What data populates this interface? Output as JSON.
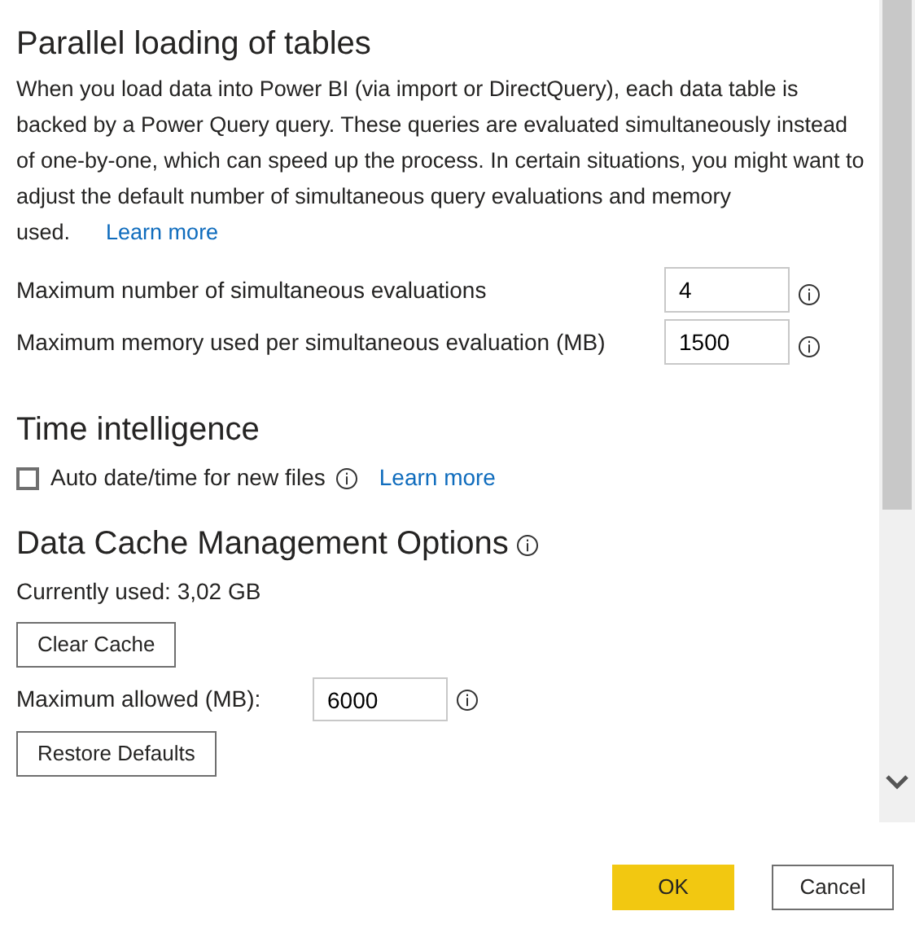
{
  "parallel_loading": {
    "heading": "Parallel loading of tables",
    "description": "When you load data into Power BI (via import or DirectQuery), each data table is backed by a Power Query query. These queries are evaluated simultaneously instead of one-by-one, which can speed up the process. In certain situations, you might want to adjust the default number of simultaneous query evaluations and memory used.",
    "learn_more": "Learn more",
    "fields": [
      {
        "label": "Maximum number of simultaneous evaluations",
        "value": "4"
      },
      {
        "label": "Maximum memory used per simultaneous evaluation (MB)",
        "value": "1500"
      }
    ]
  },
  "time_intelligence": {
    "heading": "Time intelligence",
    "checkbox": {
      "label": "Auto date/time for new files",
      "checked": false
    },
    "learn_more": "Learn more"
  },
  "data_cache": {
    "heading": "Data Cache Management Options",
    "currently_used": "Currently used: 3,02 GB",
    "clear_button": "Clear Cache",
    "max_label": "Maximum allowed (MB):",
    "max_value": "6000",
    "restore_button": "Restore Defaults"
  },
  "buttons": [
    {
      "label": "OK",
      "kind": "primary"
    },
    {
      "label": "Cancel",
      "kind": "secondary"
    }
  ]
}
